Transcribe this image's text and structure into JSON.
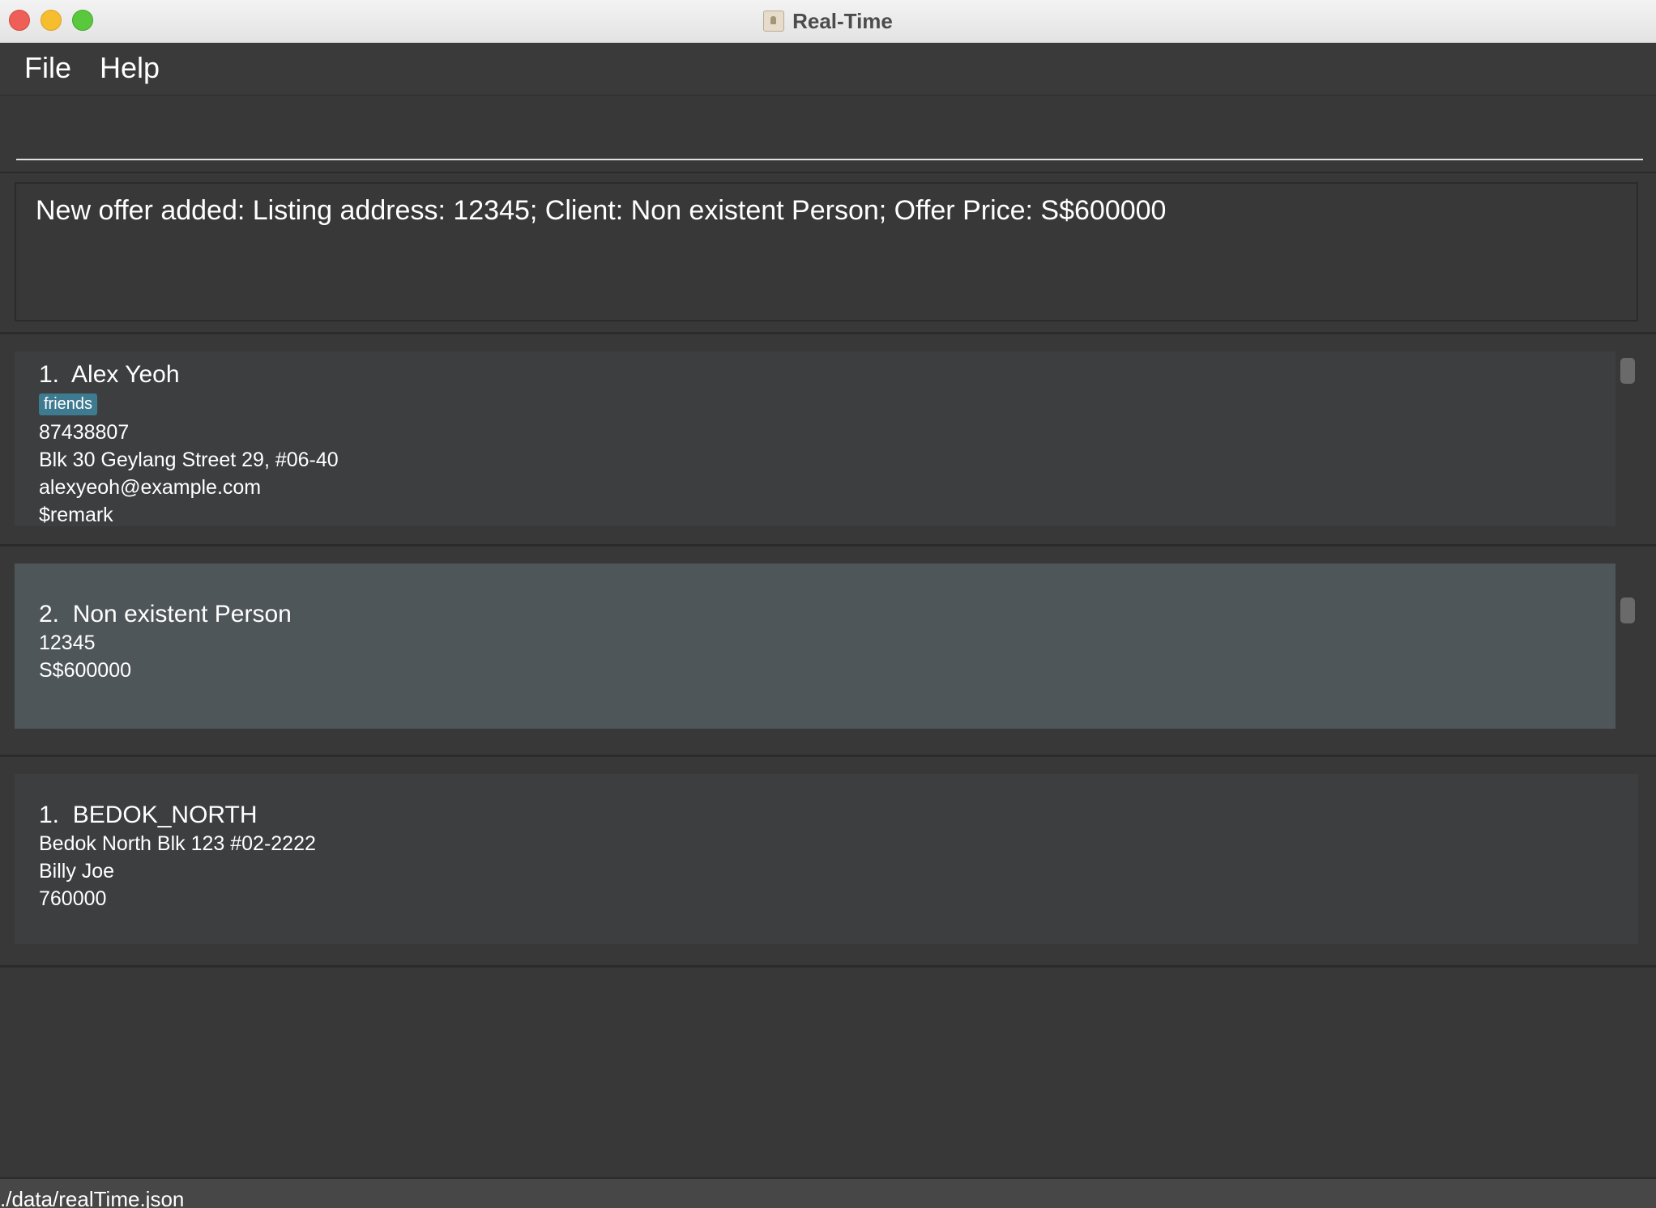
{
  "window": {
    "title": "Real-Time"
  },
  "menu": {
    "file": "File",
    "help": "Help"
  },
  "command": {
    "value": "",
    "placeholder": ""
  },
  "result": {
    "message": "New offer added: Listing address: 12345; Client: Non existent Person; Offer Price: S$600000"
  },
  "persons": [
    {
      "index": "1.",
      "name": "Alex Yeoh",
      "tags": [
        "friends"
      ],
      "phone": "87438807",
      "address": "Blk 30 Geylang Street 29, #06-40",
      "email": "alexyeoh@example.com",
      "remark": "$remark"
    }
  ],
  "offers": [
    {
      "index": "2.",
      "client": "Non existent Person",
      "listing_address": "12345",
      "price": "S$600000",
      "selected": true
    }
  ],
  "listings": [
    {
      "index": "1.",
      "name": "BEDOK_NORTH",
      "address": "Bedok North Blk 123 #02-2222",
      "owner": "Billy Joe",
      "price": "760000"
    }
  ],
  "status": {
    "file_path": "./data/realTime.json"
  },
  "colors": {
    "background": "#383838",
    "card": "#3c3e3f",
    "card_selected": "#4f5659",
    "tag": "#3e7b91"
  }
}
